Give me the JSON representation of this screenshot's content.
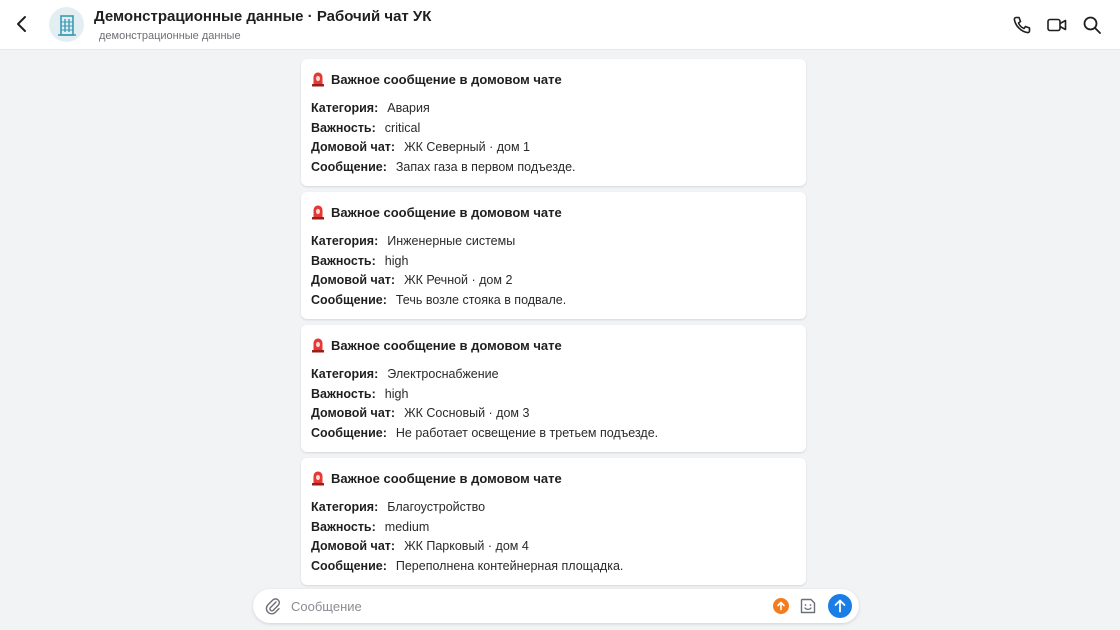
{
  "header": {
    "title": "Демонстрационные данные · Рабочий чат УК",
    "subtitle": "демонстрационные данные",
    "back_icon": "chevron-left-icon",
    "avatar_icon": "building-icon",
    "actions": [
      "phone-icon",
      "video-icon",
      "search-icon"
    ]
  },
  "messages": [
    {
      "title": "Важное сообщение в домовом чате",
      "icon": "siren-icon",
      "fields": [
        {
          "label": "Категория:",
          "value": "Авария"
        },
        {
          "label": "Важность:",
          "value": "critical"
        },
        {
          "label": "Домовой чат:",
          "value": "ЖК Северный · дом 1"
        },
        {
          "label": "Сообщение:",
          "value": "Запах газа в первом подъезде."
        }
      ]
    },
    {
      "title": "Важное сообщение в домовом чате",
      "icon": "siren-icon",
      "fields": [
        {
          "label": "Категория:",
          "value": "Инженерные системы"
        },
        {
          "label": "Важность:",
          "value": "high"
        },
        {
          "label": "Домовой чат:",
          "value": "ЖК Речной · дом 2"
        },
        {
          "label": "Сообщение:",
          "value": "Течь возле стояка в подвале."
        }
      ]
    },
    {
      "title": "Важное сообщение в домовом чате",
      "icon": "siren-icon",
      "fields": [
        {
          "label": "Категория:",
          "value": "Электроснабжение"
        },
        {
          "label": "Важность:",
          "value": "high"
        },
        {
          "label": "Домовой чат:",
          "value": "ЖК Сосновый · дом 3"
        },
        {
          "label": "Сообщение:",
          "value": "Не работает освещение в третьем подъезде."
        }
      ]
    },
    {
      "title": "Важное сообщение в домовом чате",
      "icon": "siren-icon",
      "fields": [
        {
          "label": "Категория:",
          "value": "Благоустройство"
        },
        {
          "label": "Важность:",
          "value": "medium"
        },
        {
          "label": "Домовой чат:",
          "value": "ЖК Парковый · дом 4"
        },
        {
          "label": "Сообщение:",
          "value": "Переполнена контейнерная площадка."
        }
      ]
    }
  ],
  "composer": {
    "placeholder": "Сообщение",
    "value": "",
    "icons": [
      "paperclip-icon",
      "priority-icon",
      "sticker-icon",
      "send-icon"
    ]
  },
  "colors": {
    "background": "#f2f3f5",
    "accent": "#1a7ee6",
    "priority": "#f47c20",
    "siren": "#e53935"
  }
}
